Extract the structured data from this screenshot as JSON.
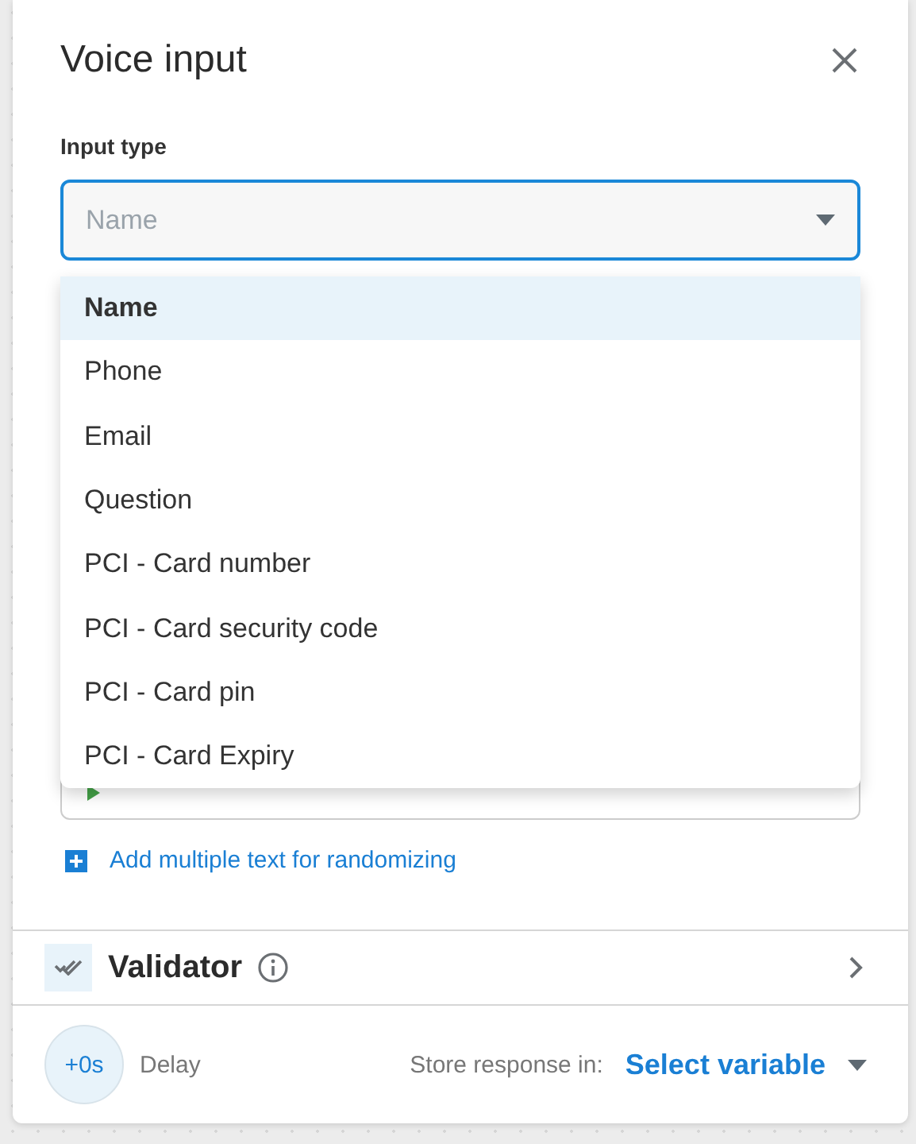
{
  "dialog": {
    "title": "Voice input"
  },
  "input_type": {
    "label": "Input type",
    "placeholder": "Name",
    "expanded": true,
    "options": [
      {
        "label": "Name",
        "selected": true
      },
      {
        "label": "Phone",
        "selected": false
      },
      {
        "label": "Email",
        "selected": false
      },
      {
        "label": "Question",
        "selected": false
      },
      {
        "label": "PCI - Card number",
        "selected": false
      },
      {
        "label": "PCI - Card security code",
        "selected": false
      },
      {
        "label": "PCI - Card pin",
        "selected": false
      },
      {
        "label": "PCI - Card Expiry",
        "selected": false
      }
    ]
  },
  "add_link": "Add multiple text for randomizing",
  "validator": {
    "title": "Validator"
  },
  "footer": {
    "delay_value": "+0s",
    "delay_label": "Delay",
    "store_label": "Store response in:",
    "store_value": "Select variable"
  }
}
